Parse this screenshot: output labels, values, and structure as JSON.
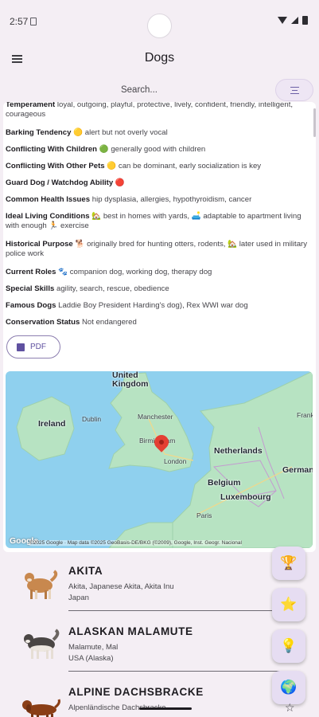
{
  "status_bar": {
    "time": "2:57"
  },
  "app_bar": {
    "title": "Dogs",
    "menu_icon": "menu-icon"
  },
  "search": {
    "placeholder": "Search...",
    "filter_icon": "tune-icon"
  },
  "details": {
    "temperament": {
      "label": "Temperament",
      "value": "loyal, outgoing, playful, protective, lively, confident, friendly, intelligent, courageous"
    },
    "barking": {
      "label": "Barking Tendency",
      "value": "🟡 alert but not overly vocal"
    },
    "children": {
      "label": "Conflicting With Children",
      "value": "🟢 generally good with children"
    },
    "pets": {
      "label": "Conflicting With Other Pets",
      "value": "🟡 can be dominant, early socialization is key"
    },
    "guard": {
      "label": "Guard Dog / Watchdog Ability",
      "value": "🔴"
    },
    "health": {
      "label": "Common Health Issues",
      "value": "hip dysplasia, allergies, hypothyroidism, cancer"
    },
    "living": {
      "label": "Ideal Living Conditions",
      "value": "🏡 best in homes with yards, 🛋️ adaptable to apartment living with enough 🏃 exercise"
    },
    "history": {
      "label": "Historical Purpose",
      "value": "🐕 originally bred for hunting otters, rodents, 🏡 later used in military police work"
    },
    "roles": {
      "label": "Current Roles",
      "value": "🐾 companion dog, working dog, therapy dog"
    },
    "skills": {
      "label": "Special Skills",
      "value": "agility, search, rescue, obedience"
    },
    "famous": {
      "label": "Famous Dogs",
      "value": "Laddie Boy President Harding's dog), Rex WWI war dog"
    },
    "conservation": {
      "label": "Conservation Status",
      "value": "Not endangered"
    }
  },
  "pdf_button": {
    "label": "PDF",
    "icon": "pdf-icon"
  },
  "map": {
    "labels": {
      "uk": "United\nKingdom",
      "ireland": "Ireland",
      "dublin": "Dublin",
      "manchester": "Manchester",
      "birmingham": "Birmingham",
      "london": "London",
      "netherlands": "Netherlands",
      "belgium": "Belgium",
      "luxembourg": "Luxembourg",
      "paris": "Paris",
      "german": "German",
      "frank": "Frank"
    },
    "google": "Google",
    "attribution": "©2025 Google · Map data ©2025 GeoBasis-DE/BKG (©2009), Google, Inst. Geogr. Nacional"
  },
  "breeds": [
    {
      "name": "AKITA",
      "aliases": "Akita, Japanese Akita, Akita Inu",
      "origin": "Japan"
    },
    {
      "name": "ALASKAN MALAMUTE",
      "aliases": "Malamute, Mal",
      "origin": "USA (Alaska)"
    },
    {
      "name": "ALPINE DACHSBRACKE",
      "aliases": "Alpenländische Dachsbracke",
      "origin": ""
    }
  ],
  "fabs": [
    {
      "icon": "trophy-icon",
      "glyph": "🏆"
    },
    {
      "icon": "star-icon",
      "glyph": "⭐"
    },
    {
      "icon": "lightbulb-icon",
      "glyph": "💡"
    },
    {
      "icon": "globe-icon",
      "glyph": "🌍"
    }
  ],
  "colors": {
    "accent": "#5f51a0",
    "background": "#f4eef4",
    "fab": "#e6ddf2",
    "map_water": "#8fd0ee",
    "map_land": "#b7e3c2"
  }
}
